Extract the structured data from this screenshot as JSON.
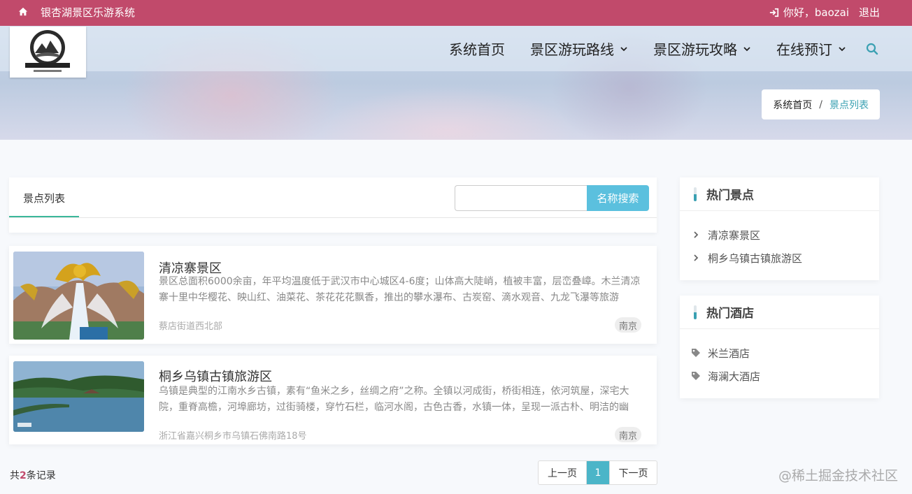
{
  "topbar": {
    "icon": "home-icon",
    "site_title": "银杏湖景区乐游系统",
    "greeting": "你好，baozai",
    "logout": "退出"
  },
  "nav": {
    "items": [
      {
        "label": "系统首页",
        "dropdown": false
      },
      {
        "label": "景区游玩路线",
        "dropdown": true
      },
      {
        "label": "景区游玩攻略",
        "dropdown": true
      },
      {
        "label": "在线预订",
        "dropdown": true
      }
    ],
    "search_icon": "search-icon"
  },
  "breadcrumb": {
    "home": "系统首页",
    "separator": "/",
    "current": "景点列表"
  },
  "list_header": {
    "tab_label": "景点列表",
    "search_value": "",
    "search_button": "名称搜索"
  },
  "spots": [
    {
      "title": "清凉寨景区",
      "description": "景区总面积6000余亩，年平均温度低于武汉市中心城区4-6度；山体高大陡峭，植被丰富，层峦叠嶂。木兰清凉寨十里中华樱花、映山红、油菜花、茶花花花飘香，推出的攀水瀑布、古炭窑、滴水观音、九龙飞瀑等旅游",
      "address": "蔡店街道西北部",
      "tag": "南京"
    },
    {
      "title": "桐乡乌镇古镇旅游区",
      "description": "乌镇是典型的江南水乡古镇，素有“鱼米之乡，丝绸之府”之称。全镇以河成街，桥街相连，依河筑屋，深宅大院，重脊高檐，河埠廊坊，过街骑楼，穿竹石栏，临河水阁，古色古香，水镇一体，呈现一派古朴、明洁的幽",
      "address": "浙江省嘉兴桐乡市乌镇石佛南路18号",
      "tag": "南京"
    }
  ],
  "pagination": {
    "total_prefix": "共",
    "total": "2",
    "total_suffix": "条记录",
    "prev": "上一页",
    "current": "1",
    "next": "下一页"
  },
  "sidebar": {
    "hot_spots": {
      "title": "热门景点",
      "items": [
        "清凉寨景区",
        "桐乡乌镇古镇旅游区"
      ]
    },
    "hot_hotels": {
      "title": "热门酒店",
      "items": [
        "米兰酒店",
        "海澜大酒店"
      ]
    }
  },
  "watermark": "@稀土掘金技术社区",
  "colors": {
    "topbar": "#c14a6b",
    "accent": "#3aa0b2",
    "search_button": "#5bc0de",
    "tab_underline": "#3bb89a"
  }
}
